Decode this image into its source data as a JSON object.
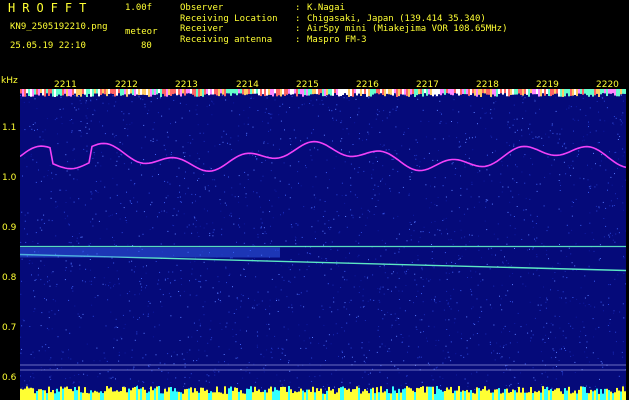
{
  "header": {
    "title": "HROFFT",
    "version": "1.00f",
    "file_name": "KN9_2505192210.png",
    "timestamp": "25.05.19 22:10",
    "meteor_label": "meteor",
    "meteor_count": "80"
  },
  "station_info": [
    {
      "key": "Observer",
      "value": "K.Nagai"
    },
    {
      "key": "Receiving Location",
      "value": "Chigasaki, Japan (139.414 35.340)"
    },
    {
      "key": "Receiver",
      "value": "AirSpy mini (Miakejima VOR 108.65MHz)"
    },
    {
      "key": "Receiving antenna",
      "value": "Maspro FM-3"
    }
  ],
  "spectrogram": {
    "unit": "kHz",
    "y_ticks": [
      "1.1",
      "1.0",
      "0.9",
      "0.8",
      "0.7",
      "0.6"
    ],
    "y_range_khz": [
      0.59,
      1.17
    ],
    "time_ticks": [
      "2211",
      "2212",
      "2213",
      "2214",
      "2215",
      "2216",
      "2217",
      "2218",
      "2219",
      "2220"
    ],
    "background_color": "#050a7a",
    "signal_color": "#ff44ff",
    "carrier_color": "#66ffcc",
    "carrier_lines_khz": [
      0.855,
      0.815
    ],
    "reference_lines_khz": [
      0.618,
      0.608
    ]
  }
}
